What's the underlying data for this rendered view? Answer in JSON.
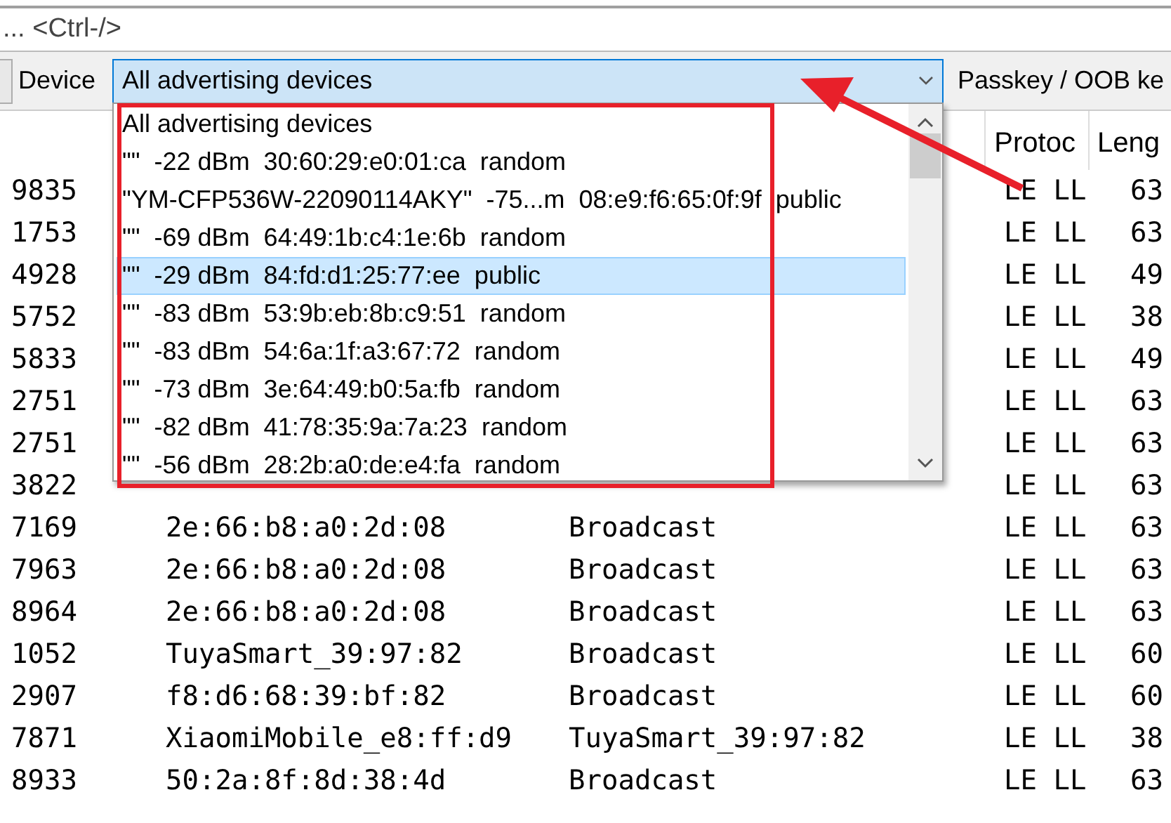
{
  "filter_bar": {
    "placeholder": "... <Ctrl-/>"
  },
  "toolbar": {
    "device_label": "Device",
    "device_combo": {
      "value": "All advertising devices",
      "expanded": true
    },
    "passkey_label": "Passkey / OOB ke"
  },
  "device_dropdown": {
    "items": [
      {
        "label": "All advertising devices",
        "selected": false
      },
      {
        "label": "\"\"  -22 dBm  30:60:29:e0:01:ca  random",
        "selected": false
      },
      {
        "label": "\"YM-CFP536W-22090114AKY\"  -75...m  08:e9:f6:65:0f:9f  public",
        "selected": false
      },
      {
        "label": "\"\"  -69 dBm  64:49:1b:c4:1e:6b  random",
        "selected": false
      },
      {
        "label": "\"\"  -29 dBm  84:fd:d1:25:77:ee  public",
        "selected": true
      },
      {
        "label": "\"\"  -83 dBm  53:9b:eb:8b:c9:51  random",
        "selected": false
      },
      {
        "label": "\"\"  -83 dBm  54:6a:1f:a3:67:72  random",
        "selected": false
      },
      {
        "label": "\"\"  -73 dBm  3e:64:49:b0:5a:fb  random",
        "selected": false
      },
      {
        "label": "\"\"  -82 dBm  41:78:35:9a:7a:23  random",
        "selected": false
      },
      {
        "label": "\"\"  -56 dBm  28:2b:a0:de:e4:fa  random",
        "selected": false
      }
    ]
  },
  "packet_list": {
    "columns": [
      "Protoc",
      "Leng"
    ],
    "rows": [
      {
        "no": "9835",
        "protocol": "LE LL",
        "length": "63"
      },
      {
        "no": "1753",
        "protocol": "LE LL",
        "length": "63"
      },
      {
        "no": "4928",
        "protocol": "LE LL",
        "length": "49"
      },
      {
        "no": "5752",
        "protocol": "LE LL",
        "length": "38"
      },
      {
        "no": "5833",
        "protocol": "LE LL",
        "length": "49"
      },
      {
        "no": "2751",
        "protocol": "LE LL",
        "length": "63"
      },
      {
        "no": "2751",
        "protocol": "LE LL",
        "length": "63"
      },
      {
        "no": "3822",
        "protocol": "LE LL",
        "length": "63"
      },
      {
        "no": "7169",
        "source": "2e:66:b8:a0:2d:08",
        "destination": "Broadcast",
        "protocol": "LE LL",
        "length": "63"
      },
      {
        "no": "7963",
        "source": "2e:66:b8:a0:2d:08",
        "destination": "Broadcast",
        "protocol": "LE LL",
        "length": "63"
      },
      {
        "no": "8964",
        "source": "2e:66:b8:a0:2d:08",
        "destination": "Broadcast",
        "protocol": "LE LL",
        "length": "63"
      },
      {
        "no": "1052",
        "source": "TuyaSmart_39:97:82",
        "destination": "Broadcast",
        "protocol": "LE LL",
        "length": "60"
      },
      {
        "no": "2907",
        "source": "f8:d6:68:39:bf:82",
        "destination": "Broadcast",
        "protocol": "LE LL",
        "length": "60"
      },
      {
        "no": "7871",
        "source": "XiaomiMobile_e8:ff:d9",
        "destination": "TuyaSmart_39:97:82",
        "protocol": "LE LL",
        "length": "38"
      },
      {
        "no": "8933",
        "source": "50:2a:8f:8d:38:4d",
        "destination": "Broadcast",
        "protocol": "LE LL",
        "length": "63"
      }
    ]
  },
  "annotations": {
    "highlight_box": true,
    "arrow": true
  }
}
